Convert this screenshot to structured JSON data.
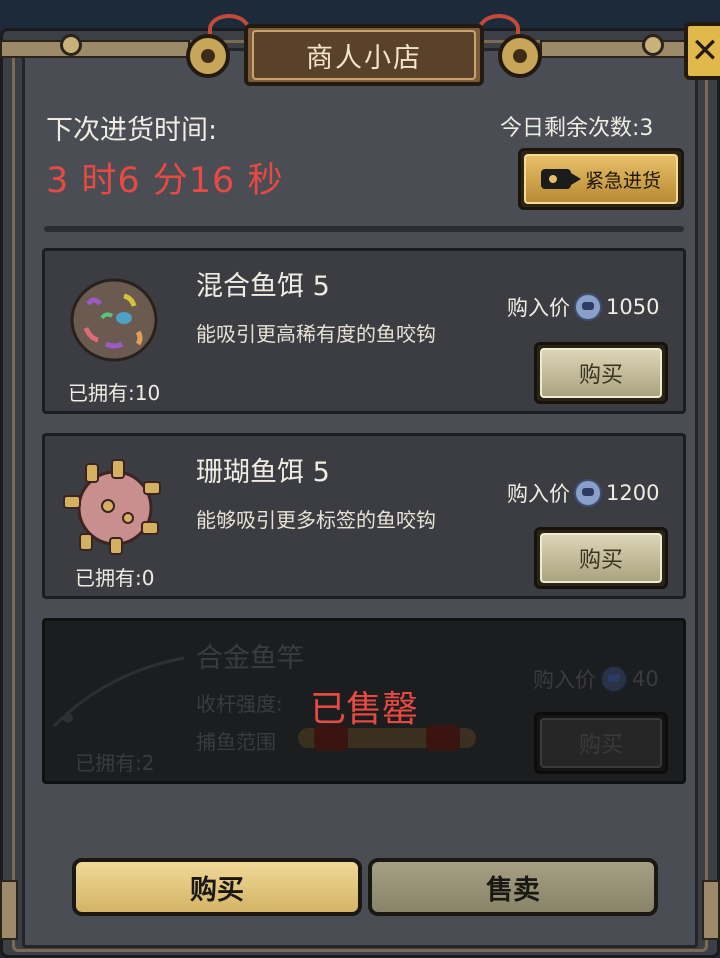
{
  "title": "商人小店",
  "close_icon": "close-icon",
  "restock": {
    "label": "下次进货时间:",
    "timer": "3 时6 分16 秒"
  },
  "remaining": "今日剩余次数:3",
  "urgent_restock": {
    "label": "紧急进货",
    "icon": "video-camera-icon"
  },
  "items": [
    {
      "name": "混合鱼饵 5",
      "desc": "能吸引更高稀有度的鱼咬钩",
      "owned": "已拥有:10",
      "price_label": "购入价",
      "price": "1050",
      "buy_label": "购买"
    },
    {
      "name": "珊瑚鱼饵 5",
      "desc": "能够吸引更多标签的鱼咬钩",
      "owned": "已拥有:0",
      "price_label": "购入价",
      "price": "1200",
      "buy_label": "购买"
    },
    {
      "name": "合金鱼竿",
      "stat1": "收杆强度:",
      "stat2": "捕鱼范围",
      "owned": "已拥有:2",
      "price_label": "购入价",
      "price": "40",
      "buy_label": "购买",
      "sold_out": "已售罄"
    }
  ],
  "tabs": {
    "buy": "购买",
    "sell": "售卖"
  },
  "colors": {
    "timer": "#e64a42",
    "accent_gold": "#e0b84c"
  }
}
